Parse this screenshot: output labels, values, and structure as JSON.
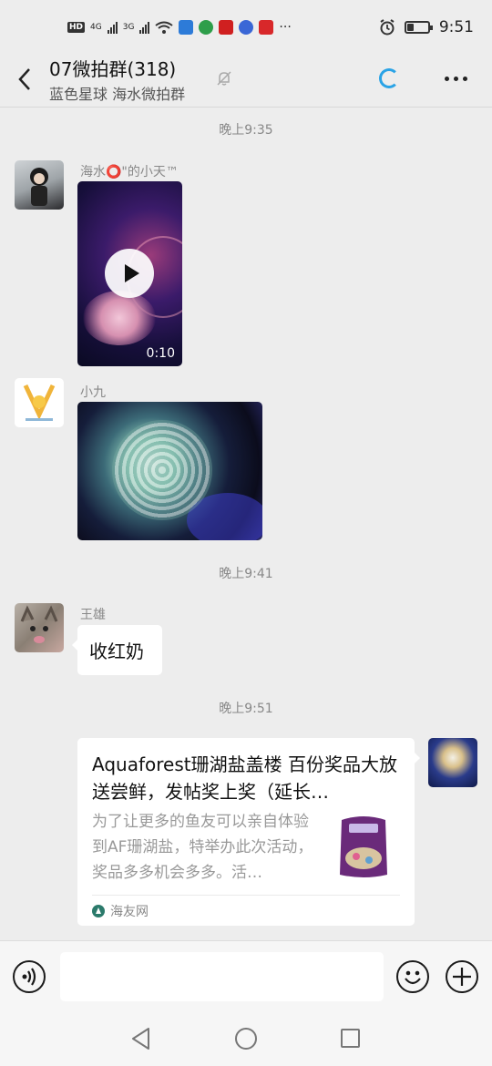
{
  "status_bar": {
    "network_badge": "HD",
    "network_1": "4G",
    "network_2": "3G",
    "more": "···",
    "time": "9:51",
    "battery_level": 0.3
  },
  "header": {
    "title": "07微拍群(318)",
    "subtitle": "蓝色星球 海水微拍群"
  },
  "messages": [
    {
      "type": "time",
      "text": "晚上9:35"
    },
    {
      "type": "video",
      "sender": "海水⭕\"的小天™",
      "duration": "0:10"
    },
    {
      "type": "image",
      "sender": "小九"
    },
    {
      "type": "time",
      "text": "晚上9:41"
    },
    {
      "type": "text",
      "sender": "王雄",
      "text": "收红奶"
    },
    {
      "type": "time",
      "text": "晚上9:51"
    },
    {
      "type": "link",
      "title": "Aquaforest珊湖盐盖楼 百份奖品大放送尝鲜，发帖奖上奖（延长…",
      "description": "为了让更多的鱼友可以亲自体验到AF珊湖盐，特举办此次活动，奖品多多机会多多。活…",
      "source": "海友网"
    }
  ],
  "input": {
    "placeholder": ""
  },
  "colors": {
    "background": "#ededed",
    "bubble": "#ffffff",
    "accent": "#2aa3e6"
  }
}
